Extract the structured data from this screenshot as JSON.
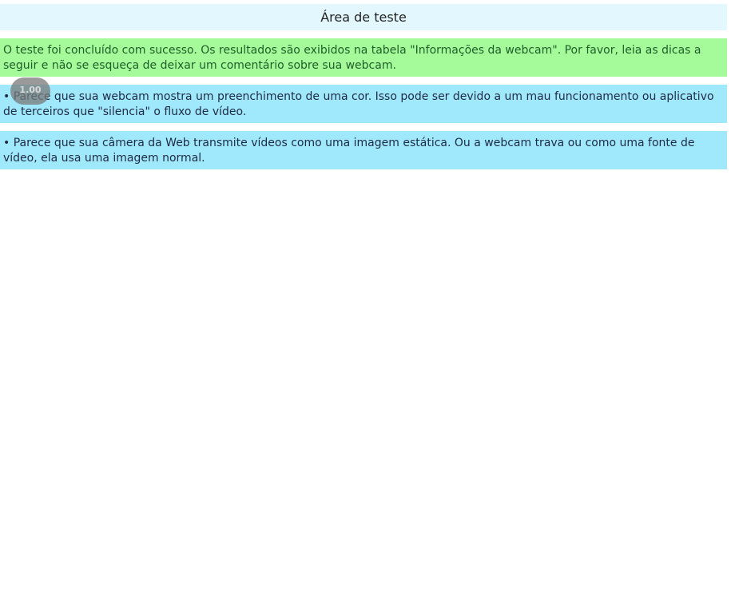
{
  "header": {
    "title": "Área de teste"
  },
  "messages": {
    "success": "O teste foi concluído com sucesso. Os resultados são exibidos na tabela \"Informações da webcam\". Por favor, leia as dicas a seguir e não se esqueça de deixar um comentário sobre sua webcam.",
    "tips": [
      "• Parece que sua webcam mostra um preenchimento de uma cor. Isso pode ser devido a um mau funcionamento ou aplicativo de terceiros que \"silencia\" o fluxo de vídeo.",
      "• Parece que sua câmera da Web transmite vídeos como uma imagem estática. Ou a webcam trava ou como uma fonte de vídeo, ela usa uma imagem normal."
    ]
  },
  "overlay": {
    "zoom_label": "1.00"
  },
  "colors": {
    "title_bg": "#e3f7fe",
    "success_bg": "#a5fb9a",
    "tip_bg": "#a0e9fc"
  }
}
